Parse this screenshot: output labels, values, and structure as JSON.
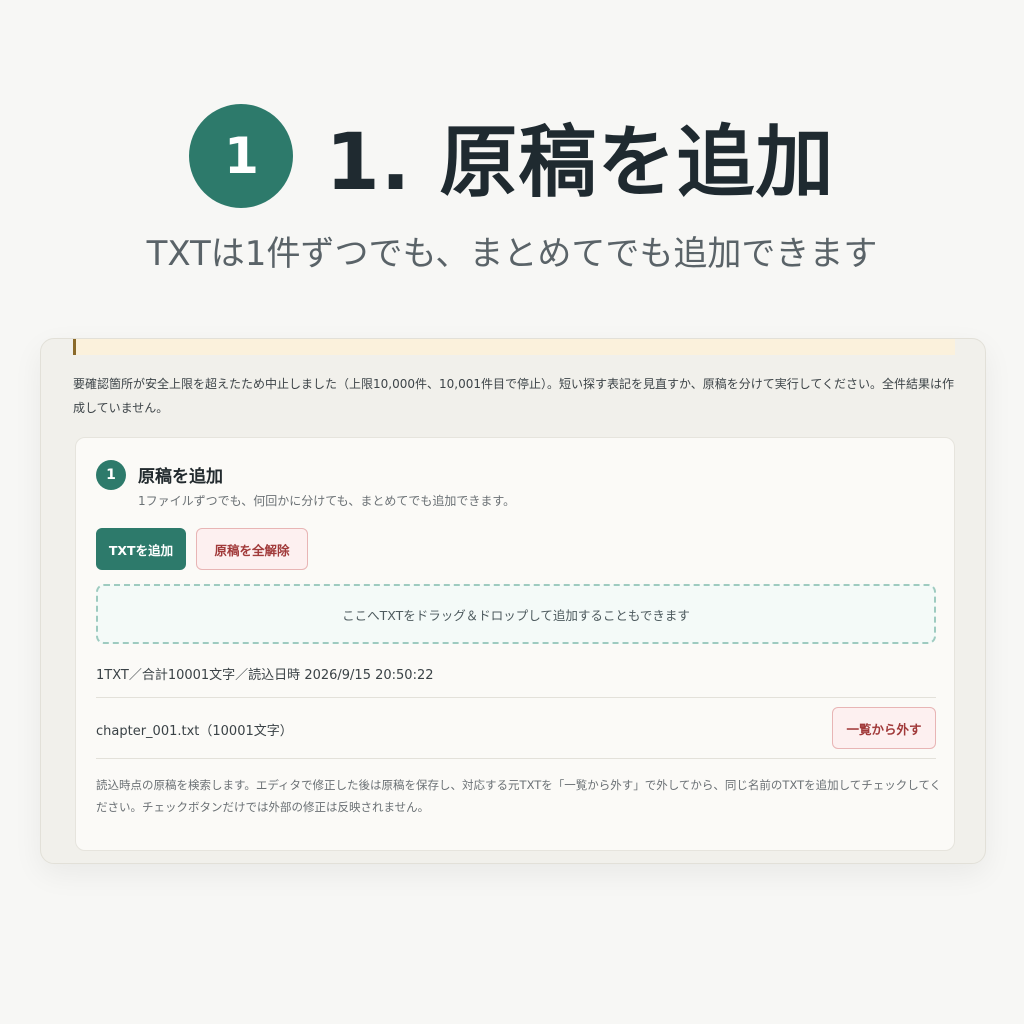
{
  "hero": {
    "badge": "1",
    "title": "1. 原稿を追加",
    "subtitle": "TXTは1件ずつでも、まとめてでも追加できます"
  },
  "warning": {
    "text": "要確認箇所が安全上限を超えたため中止しました（上限10,000件、10,001件目で停止）。短い探す表記を見直すか、原稿を分けて実行してください。全件結果は作成していません。"
  },
  "card": {
    "step": "1",
    "title": "原稿を追加",
    "description": "1ファイルずつでも、何回かに分けても、まとめてでも追加できます。",
    "add_button": "TXTを追加",
    "clear_button": "原稿を全解除",
    "dropzone": "ここへTXTをドラッグ＆ドロップして追加することもできます",
    "summary": "1TXT／合計10001文字／読込日時 2026/9/15 20:50:22",
    "files": [
      {
        "name": "chapter_001.txt（10001文字）",
        "remove_label": "一覧から外す"
      }
    ],
    "note": "読込時点の原稿を検索します。エディタで修正した後は原稿を保存し、対応する元TXTを「一覧から外す」で外してから、同じ名前のTXTを追加してチェックしてください。チェックボタンだけでは外部の修正は反映されません。"
  },
  "colors": {
    "accent": "#2d7a6b",
    "danger": "#a13a3a",
    "warning_bg": "#fbf1dc"
  }
}
